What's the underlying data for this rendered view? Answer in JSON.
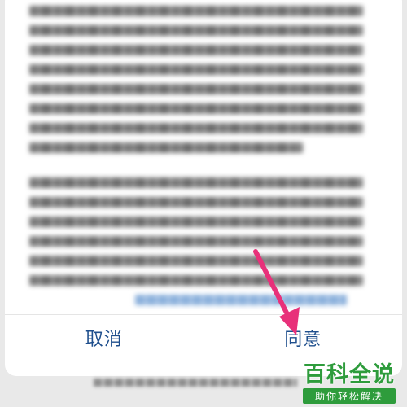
{
  "dialog": {
    "cancel_label": "取消",
    "agree_label": "同意"
  },
  "watermark": {
    "main": "百科全说",
    "sub": "助你轻松解决"
  },
  "colors": {
    "button_text": "#1f4f8d",
    "arrow": "#e8317a",
    "watermark": "#2e9c3c"
  }
}
